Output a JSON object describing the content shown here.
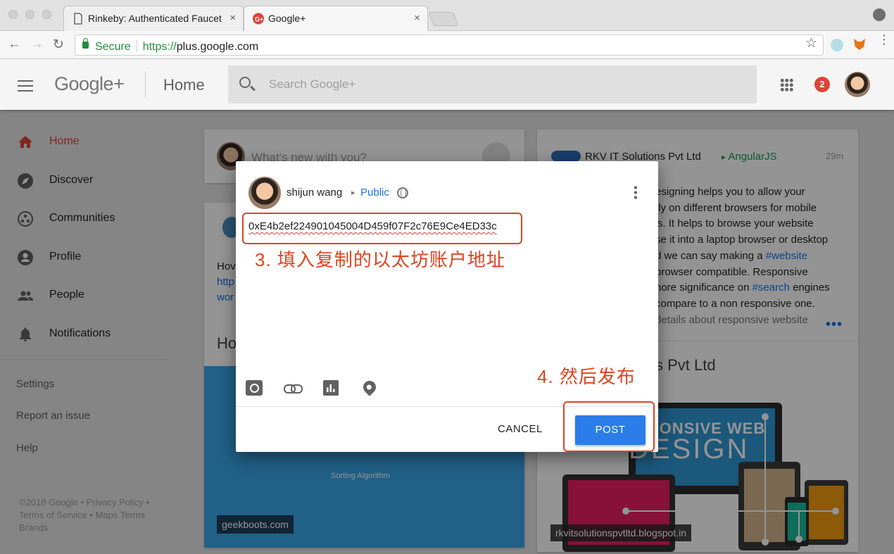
{
  "browser": {
    "tabs": [
      {
        "title": "Rinkeby: Authenticated Faucet",
        "close": "×"
      },
      {
        "title": "Google+",
        "close": "×"
      }
    ],
    "address": {
      "secure_label": "Secure",
      "scheme": "https://",
      "host": "plus.google.com"
    }
  },
  "header": {
    "logo": "Google+",
    "page_title": "Home",
    "search_placeholder": "Search Google+",
    "notification_count": "2"
  },
  "sidebar": {
    "items": [
      {
        "label": "Home",
        "icon": "home-icon",
        "active": true
      },
      {
        "label": "Discover",
        "icon": "compass-icon"
      },
      {
        "label": "Communities",
        "icon": "communities-icon"
      },
      {
        "label": "Profile",
        "icon": "account-circle-icon"
      },
      {
        "label": "People",
        "icon": "people-icon"
      },
      {
        "label": "Notifications",
        "icon": "bell-icon"
      }
    ],
    "links": [
      "Settings",
      "Report an issue",
      "Help"
    ],
    "footer": "©2018 Google • Privacy Policy • Terms of Service • Maps Terms Brands"
  },
  "feed": {
    "whats_new_placeholder": "What's new with you?",
    "left_card": {
      "text_lines": [
        "Hov",
        "http",
        "wor"
      ],
      "heading_fragment": "Ho",
      "image_caption": "Sorting Algorithm",
      "source_tag": "geekboots.com"
    },
    "right_card": {
      "author": "RKV IT Solutions Pvt Ltd",
      "community": "AngularJS",
      "time": "29m",
      "body_lines": [
        "esigning helps you to allow your",
        "tly on different browsers for mobile",
        "'s. It helps to browse your website",
        "se it into a laptop browser or desktop",
        "d we can say making a #website",
        "browser compatible. Responsive",
        "nore significance on #search engines",
        "compare to a non responsive one.",
        "details about responsive website"
      ],
      "more": "•••",
      "heading_fragment": "s Pvt Ltd",
      "image_text_1": "PONSIVE WEB",
      "image_text_2": "DESIGN",
      "image_caption": "rkvitsolutionspvtltd.blogspot.in"
    }
  },
  "dialog": {
    "user_name": "shijun wang",
    "audience": "Public",
    "post_text": "0xE4b2ef224901045004D459f07F2c76E9Ce4ED33c",
    "annotation_step3": "3. 填入复制的以太坊账户地址",
    "annotation_step4": "4. 然后发布",
    "cancel_label": "CANCEL",
    "post_label": "POST"
  },
  "colors": {
    "accent_red": "#db4437",
    "annotation_red": "#e0431f",
    "post_blue": "#2b7de9"
  }
}
